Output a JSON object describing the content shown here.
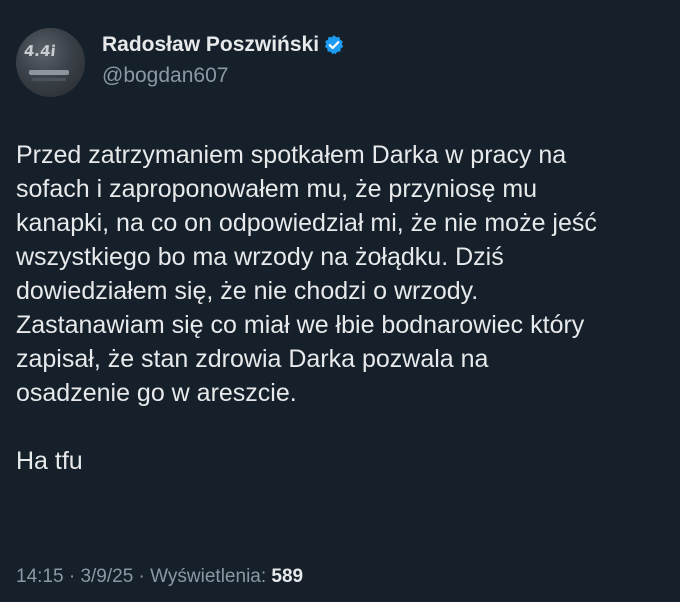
{
  "author": {
    "display_name": "Radosław Poszwiński",
    "handle": "@bogdan607",
    "avatar_text": "4.4i",
    "verified_icon": "verified-badge-icon"
  },
  "tweet": {
    "text": "Przed zatrzymaniem spotkałem Darka w pracy na\nsofach i zaproponowałem mu, że przyniosę mu\nkanapki, na co on odpowiedział mi, że nie może jeść\nwszystkiego bo ma wrzody na żołądku. Dziś\ndowiedziałem się, że nie chodzi o wrzody.\nZastanawiam się co miał we łbie bodnarowiec który\nzapisał, że stan zdrowia Darka pozwala na\nosadzenie go w areszcie.\n\nHa tfu"
  },
  "meta": {
    "time": "14:15",
    "separator": " · ",
    "date": "3/9/25",
    "views_label": "Wyświetlenia:",
    "views_count": "589"
  },
  "colors": {
    "background": "#15202b",
    "text": "#e7e9ea",
    "secondary": "#8b98a5",
    "verified": "#1d9bf0"
  }
}
